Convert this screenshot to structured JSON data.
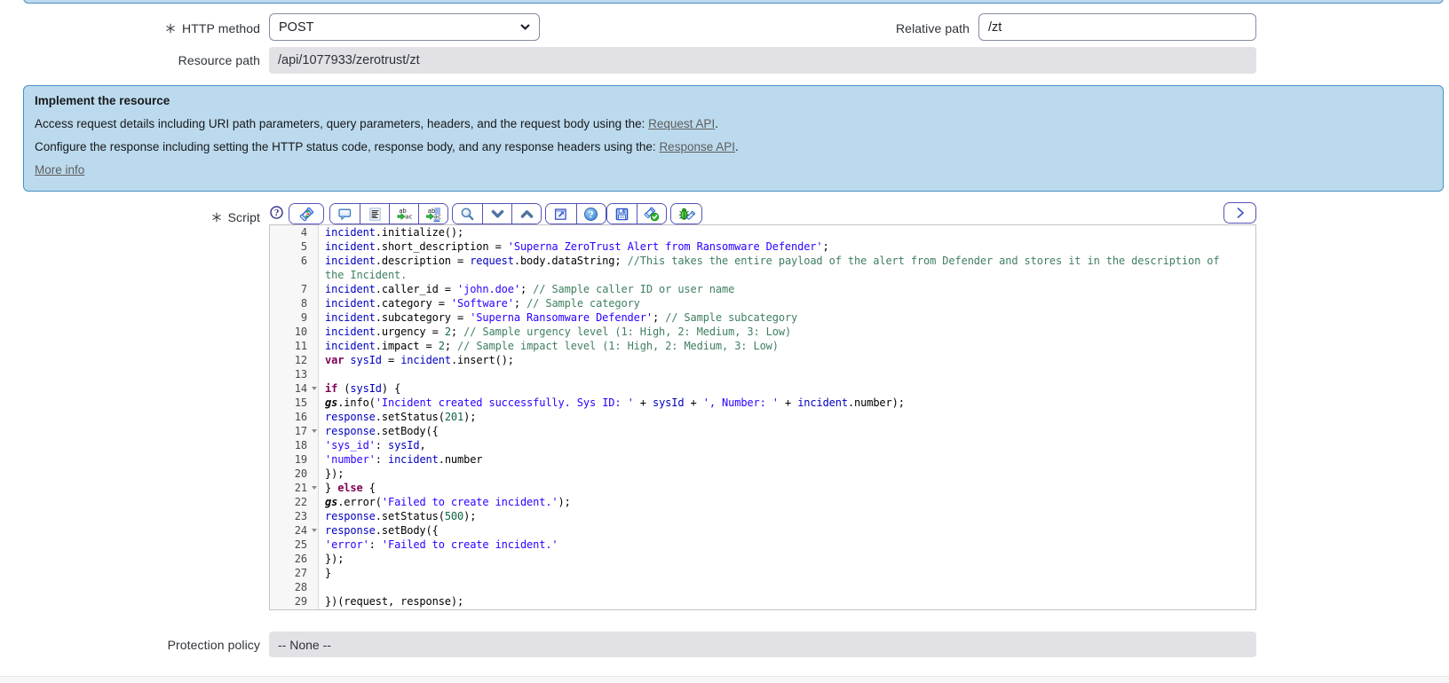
{
  "form": {
    "http_method": {
      "label": "HTTP method",
      "required": true,
      "value": "POST"
    },
    "relative_path": {
      "label": "Relative path",
      "value": "/zt"
    },
    "resource_path": {
      "label": "Resource path",
      "value": "/api/1077933/zerotrust/zt"
    },
    "script": {
      "label": "Script",
      "required": true
    },
    "protection_policy": {
      "label": "Protection policy",
      "value": "-- None --"
    }
  },
  "info_box": {
    "title": "Implement the resource",
    "lines": [
      {
        "text": "Access request details including URI path parameters, query parameters, headers, and the request body using the: ",
        "link": "Request API",
        "after": "."
      },
      {
        "text": "Configure the response including setting the HTTP status code, response body, and any response headers using the: ",
        "link": "Response API",
        "after": "."
      }
    ],
    "more_link": "More info",
    "background": "#bcdaed",
    "border_color": "#4a90c6"
  },
  "toolbar": {
    "help_icon": "script-help-icon",
    "groups": [
      {
        "buttons": [
          {
            "name": "syntax-check-button",
            "icon": "syntax-check-icon",
            "wide": true
          }
        ]
      },
      {
        "buttons": [
          {
            "name": "toggle-comment-button",
            "icon": "toggle-comment-icon"
          },
          {
            "name": "format-code-button",
            "icon": "format-code-icon"
          },
          {
            "name": "replace-button",
            "icon": "replace-icon"
          },
          {
            "name": "replace-all-button",
            "icon": "replace-all-icon"
          }
        ]
      },
      {
        "buttons": [
          {
            "name": "search-button",
            "icon": "search-icon"
          },
          {
            "name": "find-next-button",
            "icon": "find-next-icon"
          },
          {
            "name": "find-previous-button",
            "icon": "find-previous-icon"
          }
        ]
      },
      {
        "buttons": [
          {
            "name": "open-new-window-button",
            "icon": "open-new-window-icon"
          },
          {
            "name": "editor-help-button",
            "icon": "editor-help-icon"
          }
        ]
      },
      {
        "buttons": [
          {
            "name": "save-button",
            "icon": "save-icon"
          },
          {
            "name": "validate-script-button",
            "icon": "validate-icon"
          }
        ]
      },
      {
        "buttons": [
          {
            "name": "script-debugger-button",
            "icon": "debug-icon"
          }
        ]
      }
    ],
    "expand_button": {
      "name": "expand-editor-button",
      "icon": "expand-right-icon"
    }
  },
  "editor": {
    "first_visible_line": 4,
    "token_colors": {
      "plain": "#000000",
      "local_variable": "#0000c0",
      "string": "#2a00ff",
      "comment": "#3f7f5f",
      "number": "#116644",
      "keyword": "#7f0055",
      "global": "#000000"
    },
    "rows": [
      {
        "n": "4",
        "t": [
          [
            "v",
            "incident"
          ],
          [
            "p",
            ".initialize();"
          ]
        ]
      },
      {
        "n": "5",
        "t": [
          [
            "v",
            "incident"
          ],
          [
            "p",
            ".short_description = "
          ],
          [
            "s",
            "'Superna ZeroTrust Alert from Ransomware Defender'"
          ],
          [
            "p",
            ";"
          ]
        ]
      },
      {
        "n": "6",
        "t": [
          [
            "v",
            "incident"
          ],
          [
            "p",
            ".description = "
          ],
          [
            "v",
            "request"
          ],
          [
            "p",
            ".body.dataString; "
          ],
          [
            "c",
            "//This takes the entire payload of the alert from Defender and stores it in the description of"
          ]
        ]
      },
      {
        "n": "",
        "t": [
          [
            "c",
            "the Incident."
          ]
        ]
      },
      {
        "n": "7",
        "t": [
          [
            "v",
            "incident"
          ],
          [
            "p",
            ".caller_id = "
          ],
          [
            "s",
            "'john.doe'"
          ],
          [
            "p",
            "; "
          ],
          [
            "c",
            "// Sample caller ID or user name"
          ]
        ]
      },
      {
        "n": "8",
        "t": [
          [
            "v",
            "incident"
          ],
          [
            "p",
            ".category = "
          ],
          [
            "s",
            "'Software'"
          ],
          [
            "p",
            "; "
          ],
          [
            "c",
            "// Sample category"
          ]
        ]
      },
      {
        "n": "9",
        "t": [
          [
            "v",
            "incident"
          ],
          [
            "p",
            ".subcategory = "
          ],
          [
            "s",
            "'Superna Ransomware Defender'"
          ],
          [
            "p",
            "; "
          ],
          [
            "c",
            "// Sample subcategory"
          ]
        ]
      },
      {
        "n": "10",
        "t": [
          [
            "v",
            "incident"
          ],
          [
            "p",
            ".urgency = "
          ],
          [
            "n",
            "2"
          ],
          [
            "p",
            "; "
          ],
          [
            "c",
            "// Sample urgency level (1: High, 2: Medium, 3: Low)"
          ]
        ]
      },
      {
        "n": "11",
        "t": [
          [
            "v",
            "incident"
          ],
          [
            "p",
            ".impact = "
          ],
          [
            "n",
            "2"
          ],
          [
            "p",
            "; "
          ],
          [
            "c",
            "// Sample impact level (1: High, 2: Medium, 3: Low)"
          ]
        ]
      },
      {
        "n": "12",
        "t": [
          [
            "k",
            "var"
          ],
          [
            "p",
            " "
          ],
          [
            "v",
            "sysId"
          ],
          [
            "p",
            " = "
          ],
          [
            "v",
            "incident"
          ],
          [
            "p",
            ".insert();"
          ]
        ]
      },
      {
        "n": "13",
        "t": []
      },
      {
        "n": "14",
        "fold": true,
        "t": [
          [
            "k",
            "if"
          ],
          [
            "p",
            " ("
          ],
          [
            "v",
            "sysId"
          ],
          [
            "p",
            ") {"
          ]
        ]
      },
      {
        "n": "15",
        "t": [
          [
            "g",
            "gs"
          ],
          [
            "p",
            ".info("
          ],
          [
            "s",
            "'Incident created successfully. Sys ID: '"
          ],
          [
            "p",
            " + "
          ],
          [
            "v",
            "sysId"
          ],
          [
            "p",
            " + "
          ],
          [
            "s",
            "', Number: '"
          ],
          [
            "p",
            " + "
          ],
          [
            "v",
            "incident"
          ],
          [
            "p",
            ".number);"
          ]
        ]
      },
      {
        "n": "16",
        "t": [
          [
            "v",
            "response"
          ],
          [
            "p",
            ".setStatus("
          ],
          [
            "n",
            "201"
          ],
          [
            "p",
            ");"
          ]
        ]
      },
      {
        "n": "17",
        "fold": true,
        "t": [
          [
            "v",
            "response"
          ],
          [
            "p",
            ".setBody({"
          ]
        ]
      },
      {
        "n": "18",
        "t": [
          [
            "s",
            "'sys_id'"
          ],
          [
            "p",
            ": "
          ],
          [
            "v",
            "sysId"
          ],
          [
            "p",
            ","
          ]
        ]
      },
      {
        "n": "19",
        "t": [
          [
            "s",
            "'number'"
          ],
          [
            "p",
            ": "
          ],
          [
            "v",
            "incident"
          ],
          [
            "p",
            ".number"
          ]
        ]
      },
      {
        "n": "20",
        "t": [
          [
            "p",
            "});"
          ]
        ]
      },
      {
        "n": "21",
        "fold": true,
        "t": [
          [
            "p",
            "} "
          ],
          [
            "k",
            "else"
          ],
          [
            "p",
            " {"
          ]
        ]
      },
      {
        "n": "22",
        "t": [
          [
            "g",
            "gs"
          ],
          [
            "p",
            ".error("
          ],
          [
            "s",
            "'Failed to create incident.'"
          ],
          [
            "p",
            ");"
          ]
        ]
      },
      {
        "n": "23",
        "t": [
          [
            "v",
            "response"
          ],
          [
            "p",
            ".setStatus("
          ],
          [
            "n",
            "500"
          ],
          [
            "p",
            ");"
          ]
        ]
      },
      {
        "n": "24",
        "fold": true,
        "t": [
          [
            "v",
            "response"
          ],
          [
            "p",
            ".setBody({"
          ]
        ]
      },
      {
        "n": "25",
        "t": [
          [
            "s",
            "'error'"
          ],
          [
            "p",
            ": "
          ],
          [
            "s",
            "'Failed to create incident.'"
          ]
        ]
      },
      {
        "n": "26",
        "t": [
          [
            "p",
            "});"
          ]
        ]
      },
      {
        "n": "27",
        "t": [
          [
            "p",
            "}"
          ]
        ]
      },
      {
        "n": "28",
        "t": []
      },
      {
        "n": "29",
        "t": [
          [
            "p",
            "})(request, response);"
          ]
        ]
      }
    ]
  }
}
